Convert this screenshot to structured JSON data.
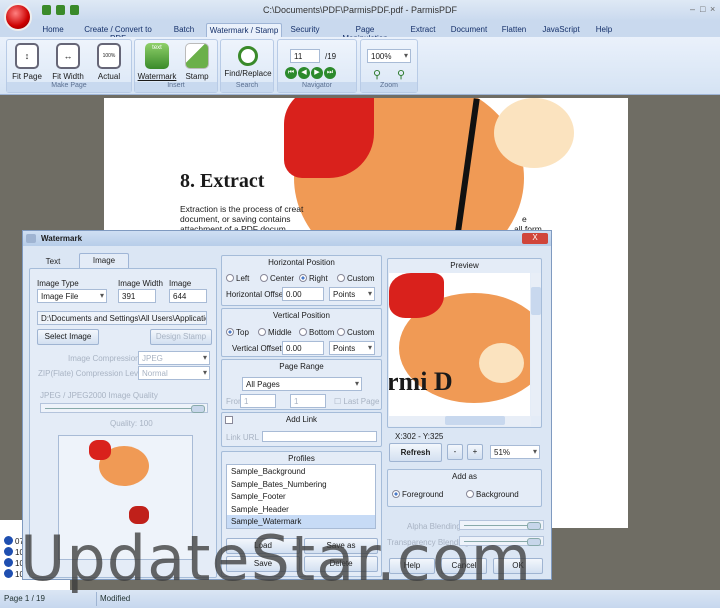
{
  "window": {
    "title": "C:\\Documents\\PDF\\ParmisPDF.pdf - ParmisPDF",
    "min": "–",
    "max": "□",
    "close": "×"
  },
  "tabs": [
    "Home",
    "Create / Convert to PDF",
    "Batch",
    "Watermark / Stamp",
    "Security",
    "Page Manipulation",
    "Extract",
    "Document",
    "Flatten",
    "JavaScript",
    "Help"
  ],
  "ribbon": {
    "make_page": {
      "label": "Make Page",
      "fit_page": "Fit Page",
      "fit_width": "Fit Width",
      "actual_size": "Actual Size",
      "actual_icon": "100%"
    },
    "insert": {
      "label": "Insert",
      "watermark": "Watermark",
      "stamp": "Stamp",
      "text_icon": "text"
    },
    "search": {
      "label": "Search",
      "find_replace": "Find/Replace"
    },
    "navigator": {
      "label": "Navigator",
      "page": "11",
      "total": "/19"
    },
    "zoom": {
      "label": "Zoom",
      "value": "100%"
    }
  },
  "document": {
    "heading": "8. Extract",
    "lines": [
      "Extraction is the process of creat",
      "document, or saving contains",
      "attachment of a PDF docum"
    ],
    "right_fragments": [
      "e",
      "all form"
    ]
  },
  "info_panel": [
    "07",
    "10",
    "10",
    "10"
  ],
  "status": {
    "page": "Page 1 / 19",
    "state": "Modified"
  },
  "dialog": {
    "title": "Watermark",
    "close": "X",
    "tabs": [
      "Text",
      "Image"
    ],
    "image": {
      "type_label": "Image Type",
      "type_value": "Image File",
      "width_label": "Image Width",
      "width_value": "391",
      "height_label": "Image Height",
      "height_value": "644",
      "path": "D:\\Documents and Settings\\All Users\\Application Da",
      "select_button": "Select Image",
      "design_button": "Design Stamp",
      "compression_label": "Image Compression",
      "compression_value": "JPEG",
      "zip_label": "ZIP(Flate) Compression Level",
      "zip_value": "Normal",
      "quality_label": "JPEG / JPEG2000 Image Quality",
      "quality_text": "Quality: 100"
    },
    "horizontal": {
      "title": "Horizontal Position",
      "options": [
        "Left",
        "Center",
        "Right",
        "Custom"
      ],
      "selected": "Right",
      "offset_label": "Horizontal Offset:",
      "offset": "0.00",
      "unit": "Points"
    },
    "vertical": {
      "title": "Vertical Position",
      "options": [
        "Top",
        "Middle",
        "Bottom",
        "Custom"
      ],
      "selected": "Top",
      "offset_label": "Vertical Offset:",
      "offset": "0.00",
      "unit": "Points"
    },
    "page_range": {
      "title": "Page Range",
      "value": "All Pages",
      "from_label": "From",
      "from": "1",
      "to": "1",
      "last_page": "Last Page"
    },
    "link": {
      "title": "Add Link",
      "url_label": "Link URL"
    },
    "profiles": {
      "title": "Profiles",
      "items": [
        "Sample_Background",
        "Sample_Bates_Numbering",
        "Sample_Footer",
        "Sample_Header",
        "Sample_Watermark"
      ],
      "selected": "Sample_Watermark",
      "load": "Load",
      "save_as": "Save as",
      "save": "Save",
      "delete": "Delete"
    },
    "preview": {
      "title": "Preview",
      "text": "rmi D",
      "coords": "X:302  -  Y:325",
      "refresh": "Refresh",
      "minus": "-",
      "plus": "+",
      "zoom": "51%"
    },
    "add_as": {
      "title": "Add as",
      "options": [
        "Foreground",
        "Background"
      ],
      "selected": "Foreground"
    },
    "alpha_label": "Alpha Blending",
    "transparency_label": "Transparency Blending",
    "help": "Help",
    "cancel": "Cancel",
    "ok": "OK"
  },
  "watermark_overlay": "UpdateStar.com"
}
